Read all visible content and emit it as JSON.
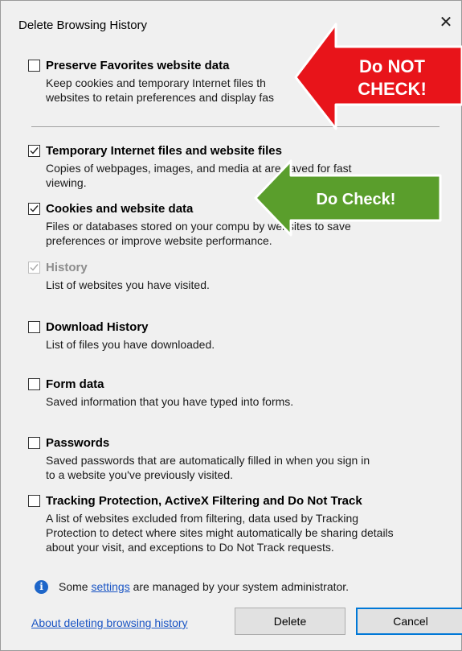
{
  "dialog": {
    "title": "Delete Browsing History",
    "close_icon": "close-icon"
  },
  "options": [
    {
      "id": "preserve-favorites",
      "label": "Preserve Favorites website data",
      "checked": false,
      "disabled": false,
      "desc_lines": [
        "Keep cookies and temporary Internet files th",
        "websites to retain preferences and display fas"
      ]
    },
    {
      "id": "temporary-files",
      "label": "Temporary Internet files and website files",
      "checked": true,
      "disabled": false,
      "desc_lines": [
        "Copies of webpages, images, and media   at are saved for fast",
        "viewing."
      ]
    },
    {
      "id": "cookies",
      "label": "Cookies and website data",
      "checked": true,
      "disabled": false,
      "desc_lines": [
        "Files or databases stored on your compu    by websites to save",
        "preferences or improve website performance."
      ]
    },
    {
      "id": "history",
      "label": "History",
      "checked": true,
      "disabled": true,
      "desc_lines": [
        "List of websites you have visited."
      ]
    },
    {
      "id": "download-history",
      "label": "Download History",
      "checked": false,
      "disabled": false,
      "desc_lines": [
        "List of files you have downloaded."
      ]
    },
    {
      "id": "form-data",
      "label": "Form data",
      "checked": false,
      "disabled": false,
      "desc_lines": [
        "Saved information that you have typed into forms."
      ]
    },
    {
      "id": "passwords",
      "label": "Passwords",
      "checked": false,
      "disabled": false,
      "desc_lines": [
        "Saved passwords that are automatically filled in when you sign in",
        "to a website you've previously visited."
      ]
    },
    {
      "id": "tracking-protection",
      "label": "Tracking Protection, ActiveX Filtering and Do Not Track",
      "checked": false,
      "disabled": false,
      "desc_lines": [
        "A list of websites excluded from filtering, data used by Tracking",
        "Protection to detect where sites might automatically be sharing details",
        "about your visit, and exceptions to Do Not Track requests."
      ]
    }
  ],
  "info": {
    "icon": "info-icon",
    "prefix": "Some ",
    "link": "settings",
    "suffix": " are managed by your system administrator."
  },
  "footer": {
    "about_link": "About deleting browsing history",
    "delete_label": "Delete",
    "cancel_label": "Cancel"
  },
  "annotations": {
    "red_arrow": {
      "line1": "Do NOT",
      "line2": "CHECK!",
      "color": "#e8141a"
    },
    "green_arrow": {
      "text": "Do Check!",
      "color": "#5a9e2c"
    }
  }
}
